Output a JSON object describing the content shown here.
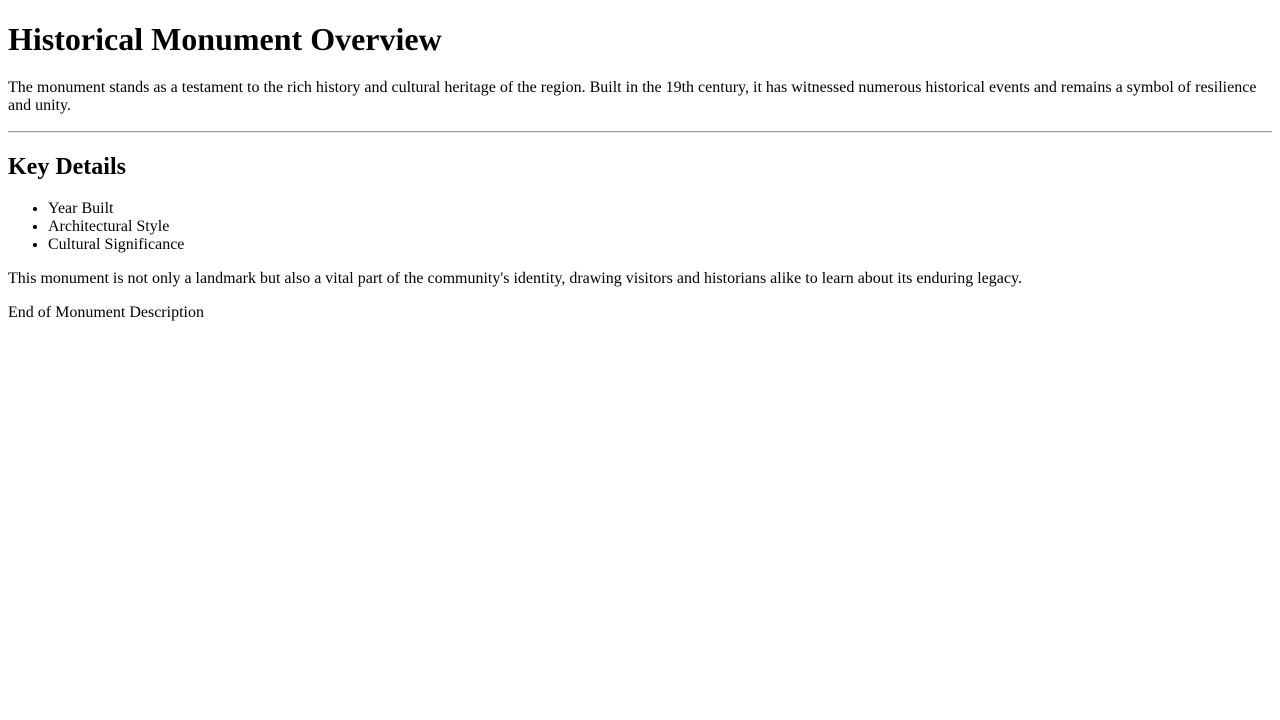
{
  "page": {
    "title": "Historical Monument Overview",
    "intro": "The monument stands as a testament to the rich history and cultural heritage of the region. Built in the 19th century, it has witnessed numerous historical events and remains a symbol of resilience and unity.",
    "section_heading": "Key Details",
    "details": [
      "Year Built",
      "Architectural Style",
      "Cultural Significance"
    ],
    "closing": "This monument is not only a landmark but also a vital part of the community's identity, drawing visitors and historians alike to learn about its enduring legacy.",
    "end_note": "End of Monument Description"
  }
}
